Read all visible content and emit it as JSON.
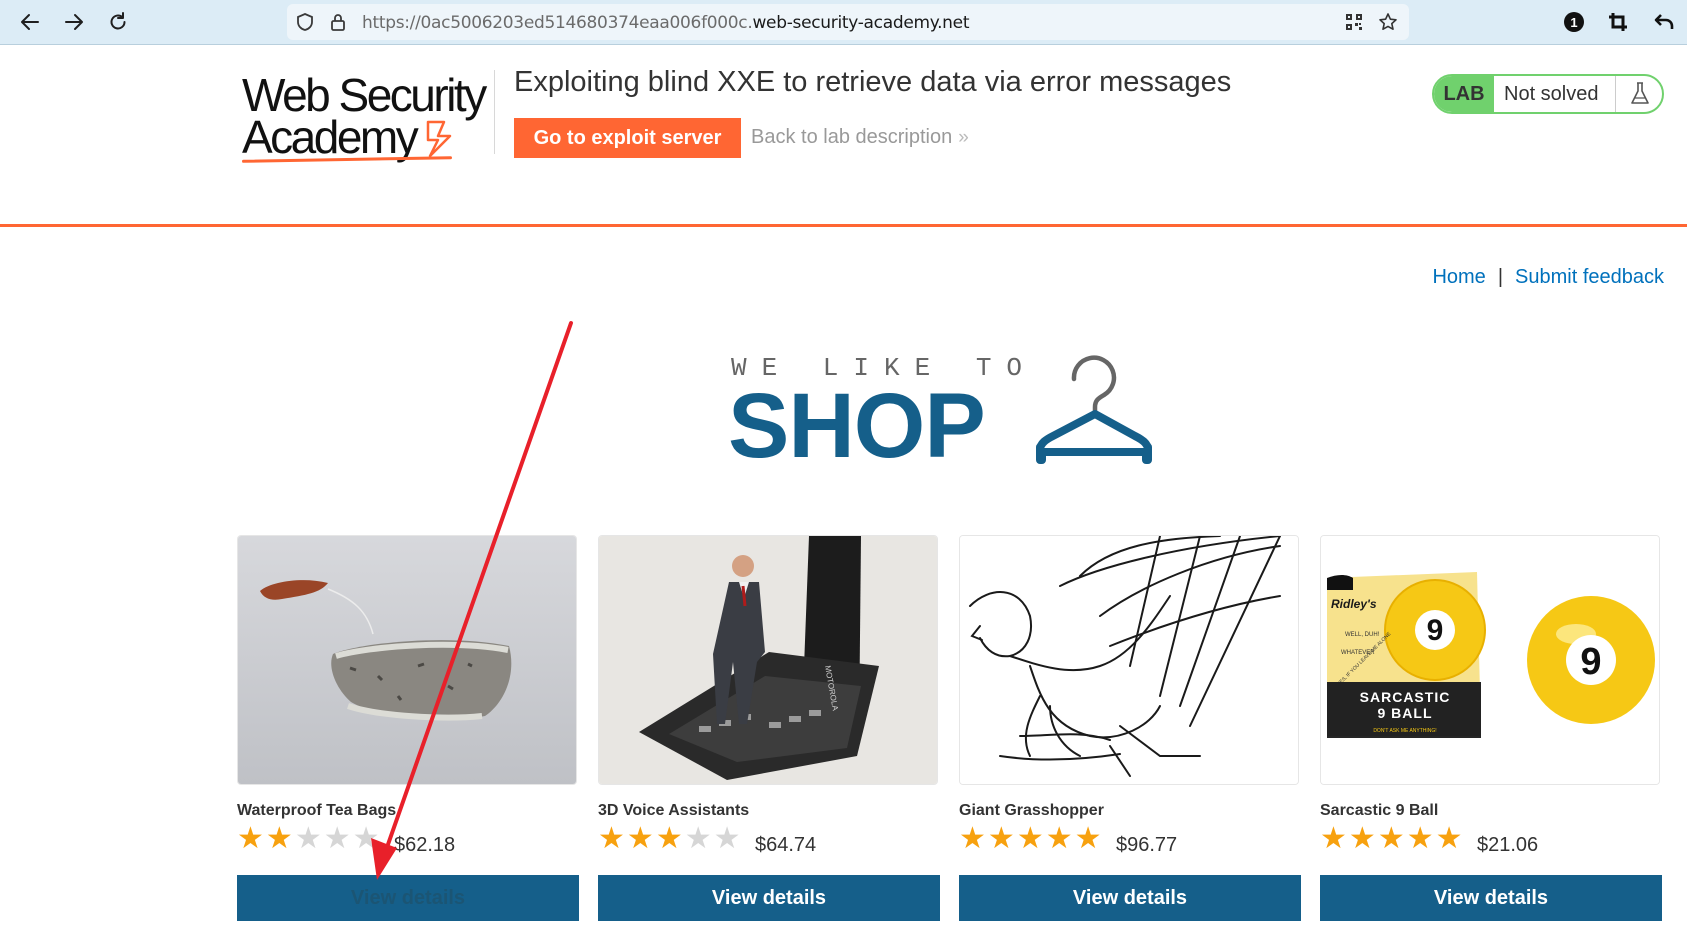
{
  "browser": {
    "url_prefix": "https://0ac5006203ed514680374eaa006f000c.",
    "url_host": "web-security-academy.net",
    "icons": [
      "back-arrow-icon",
      "forward-arrow-icon",
      "reload-icon",
      "shield-icon",
      "lock-icon",
      "qr-code-icon",
      "star-icon",
      "extension-badge-icon",
      "crop-icon",
      "undo-icon"
    ],
    "extension_badge": "1"
  },
  "academy": {
    "logo_line1": "Web Security",
    "logo_line2": "Academy",
    "lab_title": "Exploiting blind XXE to retrieve data via error messages",
    "exploit_button": "Go to exploit server",
    "back_link": "Back to lab description",
    "back_chevron": "»",
    "lab_badge": "LAB",
    "lab_state": "Not solved",
    "accent_color": "#ff6633",
    "status_color": "#70d16d"
  },
  "nav": {
    "home": "Home",
    "separator": "|",
    "feedback": "Submit feedback"
  },
  "hero": {
    "small": "WE LIKE TO",
    "big": "SHOP",
    "brand_color": "#155f8a"
  },
  "products": [
    {
      "name": "Waterproof Tea Bags",
      "rating": 2,
      "price": "$62.18",
      "button": "View details",
      "image": "tea-bag"
    },
    {
      "name": "3D Voice Assistants",
      "rating": 3,
      "price": "$64.74",
      "button": "View details",
      "image": "figurine-phone"
    },
    {
      "name": "Giant Grasshopper",
      "rating": 5,
      "price": "$96.77",
      "button": "View details",
      "image": "grasshopper-sketch"
    },
    {
      "name": "Sarcastic 9 Ball",
      "rating": 5,
      "price": "$21.06",
      "button": "View details",
      "image": "nine-ball"
    }
  ],
  "product_box_text": {
    "brand": "Ridley's",
    "line1": "WELL, DUH!",
    "line2": "WHATEVER",
    "line3": "YES, IF YOU LEAVE ME ALONE",
    "title1": "SARCASTIC",
    "title2": "9 BALL",
    "tagline": "DON'T ASK ME ANYTHING!",
    "ball_number": "9",
    "phone_brand": "MOTOROLA"
  },
  "annotation": {
    "type": "red-arrow",
    "color": "#e8202a",
    "target": "Waterproof Tea Bags view details button"
  }
}
